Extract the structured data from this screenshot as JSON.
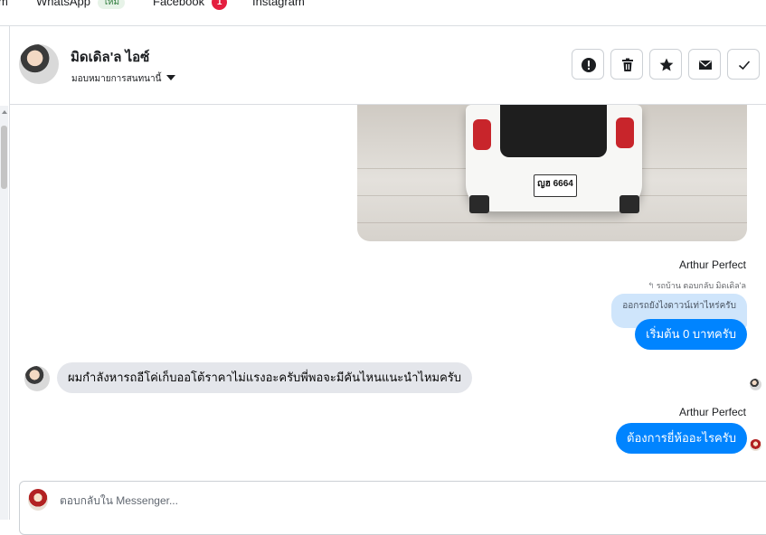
{
  "tabs": [
    {
      "label": "m"
    },
    {
      "label": "WhatsApp",
      "badge": "ใหม่"
    },
    {
      "label": "Facebook",
      "count": "1"
    },
    {
      "label": "Instagram"
    }
  ],
  "header": {
    "contact_name": "มิดเดิล'ล ไอซ์",
    "assign_label": "มอบหมายการสนทนานี้"
  },
  "actions": [
    {
      "name": "report-icon"
    },
    {
      "name": "trash-icon"
    },
    {
      "name": "star-icon"
    },
    {
      "name": "mail-icon"
    },
    {
      "name": "check-icon"
    }
  ],
  "messages": {
    "photo": {
      "plate": "ญฮ 6664"
    },
    "sender_1": "Arthur Perfect",
    "reply_note": "รถบ้าน ตอบกลับ มิดเดิล'ล",
    "quoted": "ออกรถยังไงดาวน์เท่าไหร่ครับ",
    "reply_1": "เริ่มต้น 0 บาทครับ",
    "incoming": "ผมกำลังหารถอีโค่เก็บออโต้ราคาไม่แรงอะครับพี่พอจะมีคันไหนแนะนำไหมครับ",
    "sender_2": "Arthur Perfect",
    "reply_2": "ต้องการยี่ห้ออะไรครับ"
  },
  "composer": {
    "placeholder": "ตอบกลับใน Messenger..."
  },
  "colors": {
    "outgoing_bubble": "#0084ff",
    "quoted_bubble": "#cfe5fb",
    "incoming_bubble": "#e4e6eb",
    "badge_red": "#e41e3f"
  }
}
